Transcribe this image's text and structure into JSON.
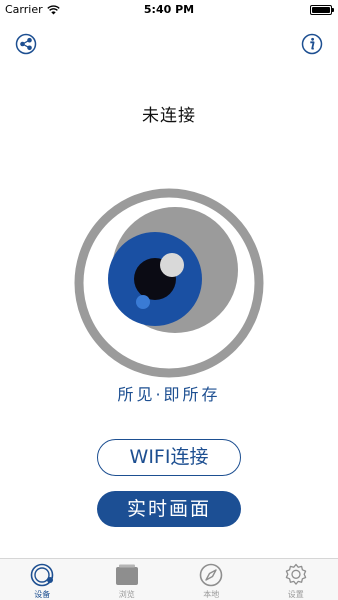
{
  "status_bar": {
    "carrier": "Carrier",
    "time": "5:40 PM"
  },
  "header": {
    "left_icon": "share-icon",
    "right_icon": "info-icon"
  },
  "main": {
    "connection_status": "未连接",
    "slogan": "所见·即所存",
    "wifi_button_label": "WIFI连接",
    "live_button_label": "实时画面"
  },
  "tab_bar": {
    "active_index": 0,
    "tabs": [
      {
        "label": "设备",
        "icon": "device-icon"
      },
      {
        "label": "浏览",
        "icon": "gallery-icon"
      },
      {
        "label": "本地",
        "icon": "compass-icon"
      },
      {
        "label": "设置",
        "icon": "settings-icon"
      }
    ]
  },
  "colors": {
    "accent": "#1d4f91",
    "ring_gray": "#9b9b9b",
    "iris_blue": "#1a50a3"
  }
}
